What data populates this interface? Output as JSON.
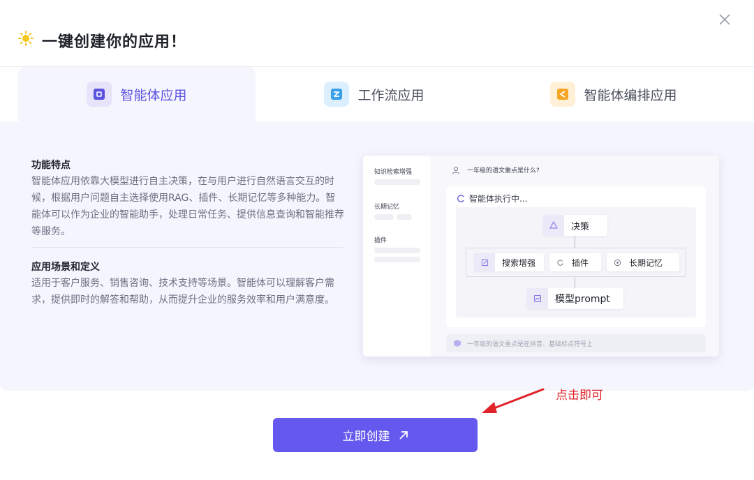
{
  "dialog": {
    "title": "一键创建你的应用！",
    "close_icon": "close-icon",
    "sun_icon": "sun-icon"
  },
  "tabs": [
    {
      "label": "智能体应用",
      "icon": "agent-app-icon",
      "active": true,
      "color": "#5b53e0"
    },
    {
      "label": "工作流应用",
      "icon": "workflow-app-icon",
      "active": false,
      "color": "#3aa0e8"
    },
    {
      "label": "智能体编排应用",
      "icon": "agent-orchestration-icon",
      "active": false,
      "color": "#f5a623"
    }
  ],
  "content": {
    "features_title": "功能特点",
    "features_text": "智能体应用依靠大模型进行自主决策，在与用户进行自然语言交互的时候，根据用户问题自主选择使用RAG、插件、长期记忆等多种能力。智能体可以作为企业的智能助手，处理日常任务、提供信息查询和智能推荐等服务。",
    "scenarios_title": "应用场景和定义",
    "scenarios_text": "适用于客户服务、销售咨询、技术支持等场景。智能体可以理解客户需求，提供即时的解答和帮助，从而提升企业的服务效率和用户满意度。"
  },
  "preview": {
    "sidebar": [
      "知识检索增强",
      "长期记忆",
      "插件"
    ],
    "question": "一年级的语文重点是什么?",
    "executing": "智能体执行中...",
    "nodes": {
      "decision": "决策",
      "search": "搜索增强",
      "plugin": "插件",
      "memory": "长期记忆",
      "model": "模型prompt"
    },
    "answer": "一年级的语文重点是在拼音、基础标点符号上"
  },
  "annotation": {
    "text": "点击即可",
    "color": "#e0232a"
  },
  "button": {
    "label": "立即创建",
    "icon": "arrow-up-right-icon",
    "color": "#6558ee"
  }
}
